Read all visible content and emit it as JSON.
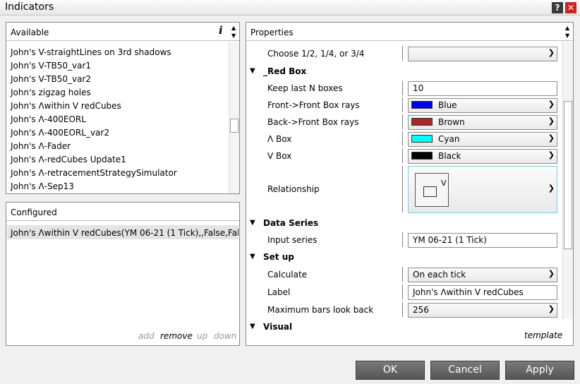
{
  "window": {
    "title": "Indicators",
    "help_label": "?",
    "close_label": "✕"
  },
  "available": {
    "title": "Available",
    "info_label": "i",
    "items": [
      "John's V-straightLines on 3rd shadows",
      "John's V-TB50_var1",
      "John's V-TB50_var2",
      "John's zigzag holes",
      "John's Λwithin V redCubes",
      "John's Λ-400EORL",
      "John's Λ-400EORL_var2",
      "John's Λ-Fader",
      "John's Λ-redCubes Update1",
      "John's Λ-retracementStrategySimulator",
      "John's Λ-Sep13"
    ]
  },
  "configured": {
    "title": "Configured",
    "items": [
      "John's Λwithin V redCubes(YM 06-21 (1 Tick),,False,Fal..."
    ],
    "actions": {
      "add": "add",
      "remove": "remove",
      "up": "up",
      "down": "down"
    }
  },
  "properties": {
    "title": "Properties",
    "choose_label": "Choose 1/2, 1/4, or 3/4",
    "choose_value": "",
    "red_box": {
      "title": "_Red Box",
      "keep_label": "Keep last N boxes",
      "keep_value": "10",
      "front_label": "Front->Front Box rays",
      "front_value": "Blue",
      "back_label": "Back->Front Box rays",
      "back_value": "Brown",
      "abox_label": "Λ Box",
      "abox_value": "Cyan",
      "vbox_label": "V Box",
      "vbox_value": "Black",
      "relationship_label": "Relationship",
      "relationship_glyph": "V"
    },
    "data_series": {
      "title": "Data Series",
      "input_label": "Input series",
      "input_value": "YM 06-21 (1 Tick)"
    },
    "setup": {
      "title": "Set up",
      "calculate_label": "Calculate",
      "calculate_value": "On each tick",
      "label_label": "Label",
      "label_value": "John's Λwithin V redCubes",
      "maxbars_label": "Maximum bars look back",
      "maxbars_value": "256"
    },
    "visual_title": "Visual",
    "template_label": "template"
  },
  "colors": {
    "Blue": "#0000ee",
    "Brown": "#a52a2a",
    "Cyan": "#00ffff",
    "Black": "#000000"
  },
  "footer": {
    "ok": "OK",
    "cancel": "Cancel",
    "apply": "Apply"
  }
}
